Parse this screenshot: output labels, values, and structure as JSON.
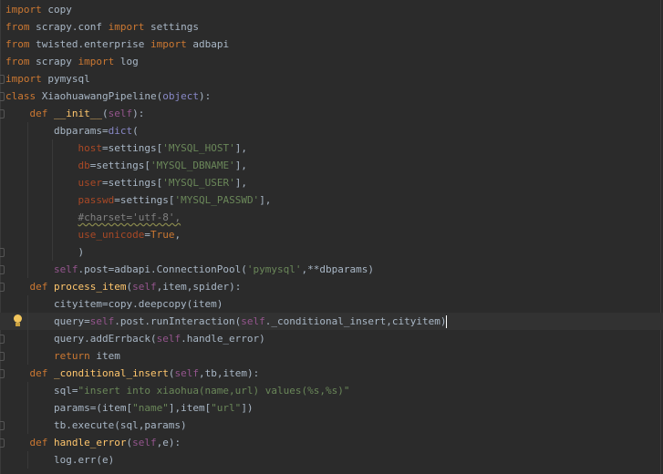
{
  "editor": {
    "language": "python",
    "current_line_index": 18,
    "lines": [
      {
        "text": "import copy"
      },
      {
        "text": "from scrapy.conf import settings"
      },
      {
        "text": "from twisted.enterprise import adbapi"
      },
      {
        "text": "from scrapy import log"
      },
      {
        "text": "import pymysql"
      },
      {
        "text": "class XiaohuawangPipeline(object):"
      },
      {
        "text": "    def __init__(self):"
      },
      {
        "text": "        dbparams=dict("
      },
      {
        "text": "            host=settings['MYSQL_HOST'],"
      },
      {
        "text": "            db=settings['MYSQL_DBNAME'],"
      },
      {
        "text": "            user=settings['MYSQL_USER'],"
      },
      {
        "text": "            passwd=settings['MYSQL_PASSWD'],"
      },
      {
        "text": "            #charset='utf-8',"
      },
      {
        "text": "            use_unicode=True,"
      },
      {
        "text": "            )"
      },
      {
        "text": "        self.post=adbapi.ConnectionPool('pymysql',**dbparams)"
      },
      {
        "text": "    def process_item(self,item,spider):"
      },
      {
        "text": "        cityitem=copy.deepcopy(item)"
      },
      {
        "text": "        query=self.post.runInteraction(self._conditional_insert,cityitem)"
      },
      {
        "text": "        query.addErrback(self.handle_error)"
      },
      {
        "text": "        return item"
      },
      {
        "text": "    def _conditional_insert(self,tb,item):"
      },
      {
        "text": "        sql=\"insert into xiaohua(name,url) values(%s,%s)\""
      },
      {
        "text": "        params=(item[\"name\"],item[\"url\"])"
      },
      {
        "text": "        tb.execute(sql,params)"
      },
      {
        "text": "    def handle_error(self,e):"
      },
      {
        "text": "        log.err(e)"
      }
    ]
  },
  "colors": {
    "background": "#2b2b2b",
    "current_line": "#323232",
    "keyword": "#cc7832",
    "function": "#ffc66d",
    "string": "#6a8759",
    "comment": "#808080",
    "self": "#94558d",
    "kwarg": "#aa4926",
    "default_text": "#a9b7c6"
  },
  "icons": {
    "intention_bulb": "lightbulb-icon",
    "fold_marker": "fold-marker-icon"
  }
}
